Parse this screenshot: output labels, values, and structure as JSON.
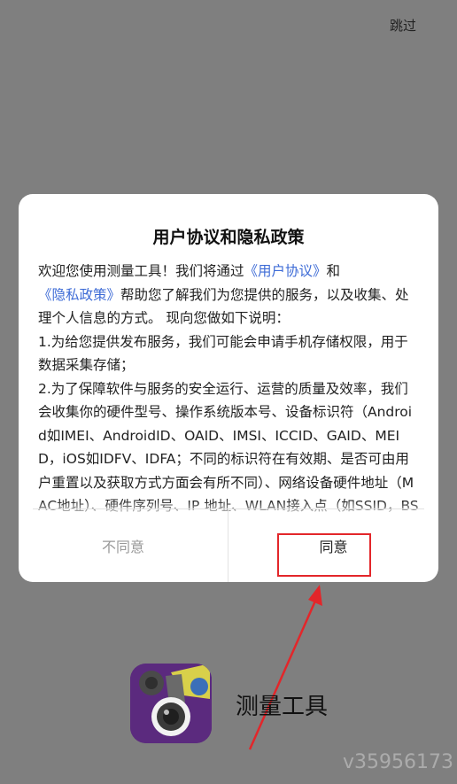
{
  "header": {
    "skip_label": "跳过"
  },
  "dialog": {
    "title": "用户协议和隐私政策",
    "body": {
      "intro_before": "欢迎您使用测量工具！我们将通过",
      "link_user_agreement": "《用户协议》",
      "and": "和",
      "link_privacy_policy": "《隐私政策》",
      "intro_after": "帮助您了解我们为您提供的服务，以及收集、处理个人信息的方式。 现向您做如下说明：",
      "item1": "1.为给您提供发布服务，我们可能会申请手机存储权限，用于数据采集存储；",
      "item2": "2.为了保障软件与服务的安全运行、运营的质量及效率，我们会收集你的硬件型号、操作系统版本号、设备标识符（Android如IMEI、AndroidID、OAID、IMSI、ICCID、GAID、MEID，iOS如IDFV、IDFA；不同的标识符在有效期、是否可由用户重置以及获取方式方面会有所不同）、网络设备硬件地址（MAC地址）、硬件序列号、IP 地址、WLAN接入点（如SSID，BSSID）、蓝牙（Bluetooth）、基"
    },
    "disagree_label": "不同意",
    "agree_label": "同意"
  },
  "app": {
    "name": "测量工具",
    "icon": "camera-measure-app-icon"
  },
  "watermark": "v35956173",
  "colors": {
    "link": "#3d6bd6",
    "annotation": "#e3262a",
    "backdrop": "#7f7f7f"
  }
}
